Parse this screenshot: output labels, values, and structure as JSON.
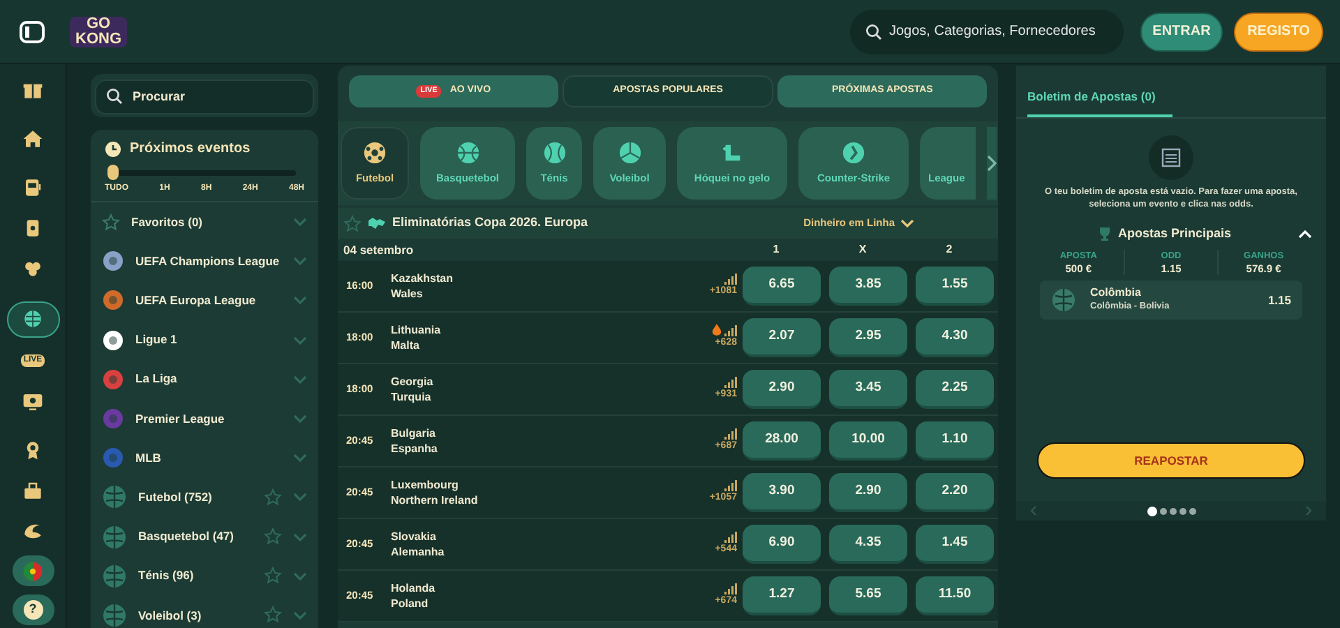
{
  "header": {
    "logo": [
      "GO",
      "KONG"
    ],
    "search": {
      "placeholder": "Jogos, Categorias, Fornecedores"
    },
    "buttons": [
      {
        "label": "ENTRAR",
        "kind": "login"
      },
      {
        "label": "REGISTO",
        "kind": "register"
      }
    ]
  },
  "rail": [
    {
      "selected": false
    },
    {
      "selected": false
    },
    {
      "selected": false
    },
    {
      "selected": false
    },
    {
      "selected": false
    },
    {
      "selected": true
    },
    {
      "selected": false,
      "badge": "LIVE"
    },
    {
      "selected": false
    },
    {
      "selected": false
    },
    {
      "selected": false
    },
    {
      "selected": false
    },
    {
      "selected": false
    },
    {
      "selected": false,
      "label": "?"
    }
  ],
  "sidebar": {
    "search": {
      "placeholder": "Procurar"
    },
    "upcoming": {
      "title": "Próximos eventos",
      "level": 0,
      "ticks": [
        "TUDO",
        "1H",
        "8H",
        "24H",
        "48H"
      ]
    },
    "items": [
      {
        "label": "Favoritos (0)",
        "kind": "favorites"
      },
      {
        "label": "UEFA Champions League",
        "kind": "league"
      },
      {
        "label": "UEFA Europa League",
        "kind": "league"
      },
      {
        "label": "Ligue 1",
        "kind": "league"
      },
      {
        "label": "La Liga",
        "kind": "league"
      },
      {
        "label": "Premier League",
        "kind": "league"
      },
      {
        "label": "MLB",
        "kind": "league"
      },
      {
        "label": "Futebol (752)",
        "kind": "sport"
      },
      {
        "label": "Basquetebol (47)",
        "kind": "sport"
      },
      {
        "label": "Ténis (96)",
        "kind": "sport"
      },
      {
        "label": "Voleibol (3)",
        "kind": "sport"
      }
    ]
  },
  "main": {
    "tabs": [
      {
        "label": "AO VIVO",
        "badge": "LIVE",
        "selected": true
      },
      {
        "label": "APOSTAS POPULARES",
        "selected": false
      },
      {
        "label": "PRÓXIMAS APOSTAS",
        "selected": true
      }
    ],
    "sports": [
      {
        "label": "Futebol",
        "selected": true
      },
      {
        "label": "Basquetebol",
        "selected": false
      },
      {
        "label": "Ténis",
        "selected": false
      },
      {
        "label": "Voleibol",
        "selected": false
      },
      {
        "label": "Hóquei no gelo",
        "selected": false
      },
      {
        "label": "Counter-Strike",
        "selected": false
      },
      {
        "label": "League",
        "selected": false
      }
    ],
    "competition": {
      "title": "Eliminatórias Copa 2026. Europa",
      "market": "Dinheiro em Linha",
      "date": "04 setembro",
      "columns": [
        "1",
        "X",
        "2"
      ],
      "rows": [
        {
          "time": "16:00",
          "home": "Kazakhstan",
          "away": "Wales",
          "markets": "+1081",
          "hot": false,
          "odds": [
            "6.65",
            "3.85",
            "1.55"
          ]
        },
        {
          "time": "18:00",
          "home": "Lithuania",
          "away": "Malta",
          "markets": "+628",
          "hot": true,
          "odds": [
            "2.07",
            "2.95",
            "4.30"
          ]
        },
        {
          "time": "18:00",
          "home": "Georgia",
          "away": "Turquia",
          "markets": "+931",
          "hot": false,
          "odds": [
            "2.90",
            "3.45",
            "2.25"
          ]
        },
        {
          "time": "20:45",
          "home": "Bulgaria",
          "away": "Espanha",
          "markets": "+687",
          "hot": false,
          "odds": [
            "28.00",
            "10.00",
            "1.10"
          ]
        },
        {
          "time": "20:45",
          "home": "Luxembourg",
          "away": "Northern Ireland",
          "markets": "+1057",
          "hot": false,
          "odds": [
            "3.90",
            "2.90",
            "2.20"
          ]
        },
        {
          "time": "20:45",
          "home": "Slovakia",
          "away": "Alemanha",
          "markets": "+544",
          "hot": false,
          "odds": [
            "6.90",
            "4.35",
            "1.45"
          ]
        },
        {
          "time": "20:45",
          "home": "Holanda",
          "away": "Poland",
          "markets": "+674",
          "hot": false,
          "odds": [
            "1.27",
            "5.65",
            "11.50"
          ]
        }
      ]
    }
  },
  "betslip": {
    "tab": "Boletim de Apostas (0)",
    "empty_message": "O teu boletim de aposta está vazio. Para fazer uma aposta, seleciona um evento e clica nas odds.",
    "section": {
      "title": "Apostas Principais",
      "expanded": true
    },
    "stats": [
      {
        "label": "APOSTA",
        "value": "500 €"
      },
      {
        "label": "ODD",
        "value": "1.15"
      },
      {
        "label": "GANHOS",
        "value": "576.9 €"
      }
    ],
    "selection": {
      "name": "Colômbia",
      "event": "Colômbia - Bolivia",
      "odd": "1.15"
    },
    "button": "REAPOSTAR",
    "dots": [
      {
        "selected": true
      },
      {
        "selected": false
      },
      {
        "selected": false
      },
      {
        "selected": false
      },
      {
        "selected": false
      }
    ]
  }
}
